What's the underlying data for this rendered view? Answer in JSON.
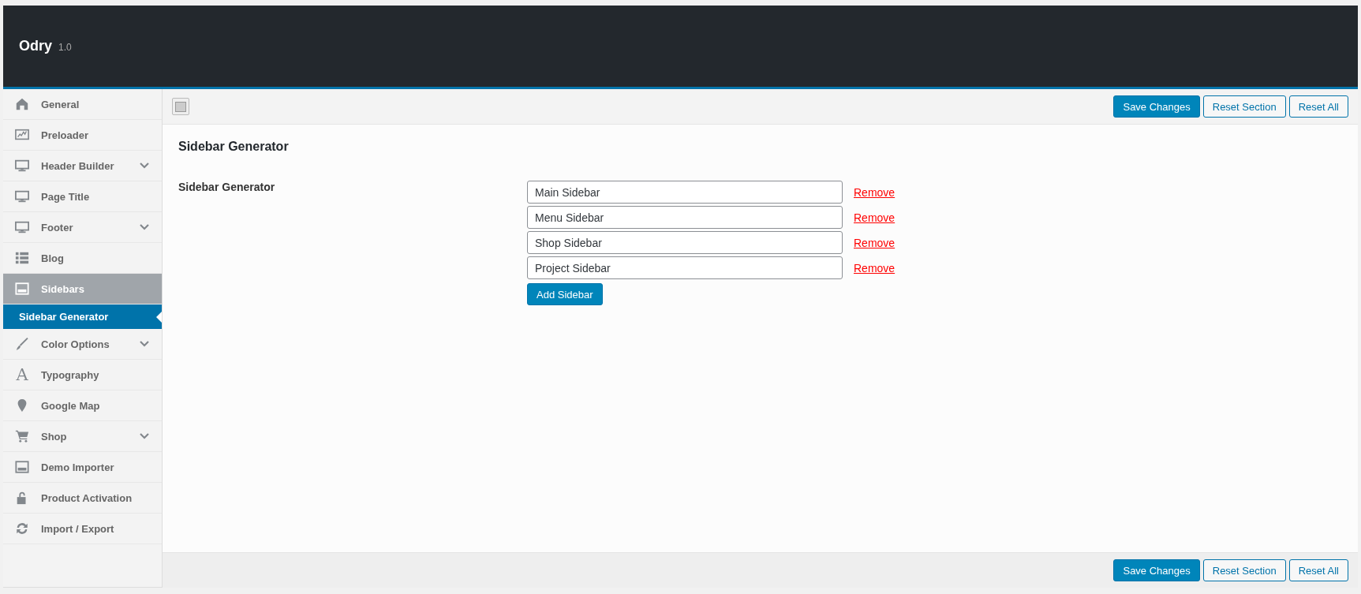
{
  "header": {
    "title": "Odry",
    "version": "1.0"
  },
  "menu": [
    {
      "label": "General",
      "selected": false
    },
    {
      "label": "Preloader",
      "selected": false
    },
    {
      "label": "Header Builder",
      "selected": false,
      "expanded": false
    },
    {
      "label": "Page Title",
      "selected": false
    },
    {
      "label": "Footer",
      "selected": false,
      "expanded": false
    },
    {
      "label": "Blog",
      "selected": false
    },
    {
      "label": "Sidebars",
      "selected": true,
      "expanded": true,
      "children": [
        {
          "label": "Sidebar Generator",
          "selected": true
        }
      ]
    },
    {
      "label": "Color Options",
      "selected": false,
      "expanded": false
    },
    {
      "label": "Typography",
      "selected": false,
      "glyph": "A"
    },
    {
      "label": "Google Map",
      "selected": false
    },
    {
      "label": "Shop",
      "selected": false,
      "expanded": false
    },
    {
      "label": "Demo Importer",
      "selected": false
    },
    {
      "label": "Product Activation",
      "selected": false
    },
    {
      "label": "Import / Export",
      "selected": false
    }
  ],
  "top_bar": {
    "buttons": [
      {
        "label": "Save Changes",
        "kind": "primary"
      },
      {
        "label": "Reset Section",
        "kind": "secondary"
      },
      {
        "label": "Reset All",
        "kind": "secondary"
      }
    ]
  },
  "section": {
    "title": "Sidebar Generator",
    "field_label": "Sidebar Generator",
    "sidebars": [
      {
        "value": "Main Sidebar",
        "remove": "Remove"
      },
      {
        "value": "Menu Sidebar",
        "remove": "Remove"
      },
      {
        "value": "Shop Sidebar",
        "remove": "Remove"
      },
      {
        "value": "Project Sidebar",
        "remove": "Remove"
      }
    ],
    "add_button": "Add Sidebar"
  },
  "bottom_bar": {
    "buttons": [
      {
        "label": "Save Changes",
        "kind": "primary"
      },
      {
        "label": "Reset Section",
        "kind": "secondary"
      },
      {
        "label": "Reset All",
        "kind": "secondary"
      }
    ]
  }
}
